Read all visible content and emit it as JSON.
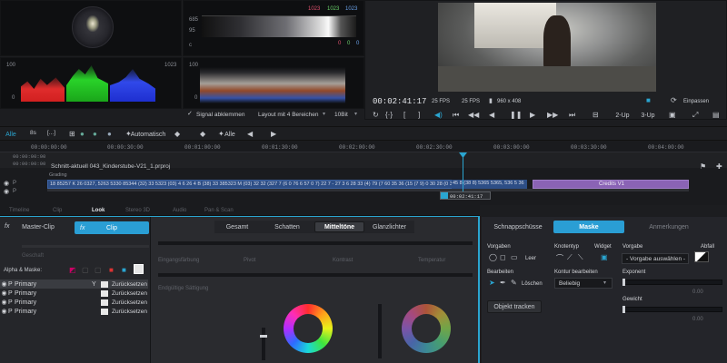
{
  "scopes": {
    "hist_top": {
      "v1023a": "1023",
      "v1023b": "1023",
      "v1023c": "1023",
      "v685": "685",
      "v95": "95",
      "vc": "c",
      "v0a": "0",
      "v0b": "0",
      "v0c": "0"
    },
    "parade": {
      "v100": "100",
      "v1023": "1023",
      "v0": "0"
    },
    "wave": {
      "v100": "100",
      "v0": "0"
    },
    "signal_label": "Signal abklemmen",
    "layout_label": "Layout mit 4 Bereichen",
    "bit_label": "10Bit"
  },
  "viewer": {
    "timecode": "00:02:41:17",
    "fps1": "25 FPS",
    "fps2": "25 FPS",
    "resolution": "960 x 408",
    "fit_label": "Einpassen",
    "up2": "2-Up",
    "up3": "3-Up"
  },
  "toolbar": {
    "alle": "Alle",
    "auto": "Automatisch",
    "alle2": "Alle"
  },
  "timeline": {
    "ruler": [
      "00:00:00:00",
      "00:00:30:00",
      "00:01:00:00",
      "00:01:30:00",
      "00:02:00:00",
      "00:02:30:00",
      "00:03:00:00",
      "00:03:30:00",
      "00:04:00:00"
    ],
    "tc1": "00:00:00:00",
    "tc2": "00:00:00:00",
    "project": "Schnitt-aktuell 043_Kinderstube-V21_1.prproj",
    "grading": "Grading",
    "strip": "18 85257 K 26 0327, 5263 5330 85344 (32) 33 5323 (03) 4 6 26 4 B (38) 33 385323 M (03) 32 32 (327 7 (6 0 76 6 57 0 7) 22 7 - 27 3 6 28 33 (4) 79 (7 60 35 36 (15 (7 9) 0 30 28 (0 37 3 7 (0 28 (27) 5358 38 45",
    "strip_end": "45 8 (38 8) 5365 5365, 536 5 36",
    "credits": "Credits V1",
    "playhead_tc": "00:02:41:17"
  },
  "tabs": {
    "bottom": [
      "Timeline",
      "Clip",
      "Look",
      "Stereo 3D",
      "Audio",
      "Pan & Scan"
    ],
    "active": "Look"
  },
  "left_panel": {
    "master": "Master-Clip",
    "clip": "Clip",
    "faded": "Geschaft",
    "alpha_label": "Alpha & Maske:",
    "rows": [
      {
        "name": "Primary",
        "reset": "Zurücksetzen"
      },
      {
        "name": "Primary",
        "reset": "Zurücksetzen"
      },
      {
        "name": "Primary",
        "reset": "Zurücksetzen"
      },
      {
        "name": "Primary",
        "reset": "Zurücksetzen"
      }
    ]
  },
  "center_panel": {
    "tabs": [
      "Gesamt",
      "Schatten",
      "Mitteltöne",
      "Glanzlichter"
    ],
    "active": "Mitteltöne",
    "labels": [
      "Eingangsfärbung",
      "Pivot",
      "Kontrast",
      "Temperatur"
    ],
    "label2": "Endgültige Sättigung"
  },
  "right_panel": {
    "tabs": [
      "Schnappschüsse",
      "Maske",
      "Anmerkungen"
    ],
    "active": "Maske",
    "vorgaben": "Vorgaben",
    "knotentyp": "Knotentyp",
    "widget": "Widget",
    "vorgabe": "Vorgabe",
    "abfall": "Abfall",
    "leer": "Leer",
    "vorgabe_select": "- Vorgabe auswählen -",
    "bearbeiten": "Bearbeiten",
    "kontur": "Kontur bearbeiten",
    "exponent": "Exponent",
    "loeschen": "Löschen",
    "beliebig": "Beliebig",
    "val1": "0.00",
    "gewicht": "Gewicht",
    "track": "Objekt tracken",
    "val2": "0.00"
  }
}
